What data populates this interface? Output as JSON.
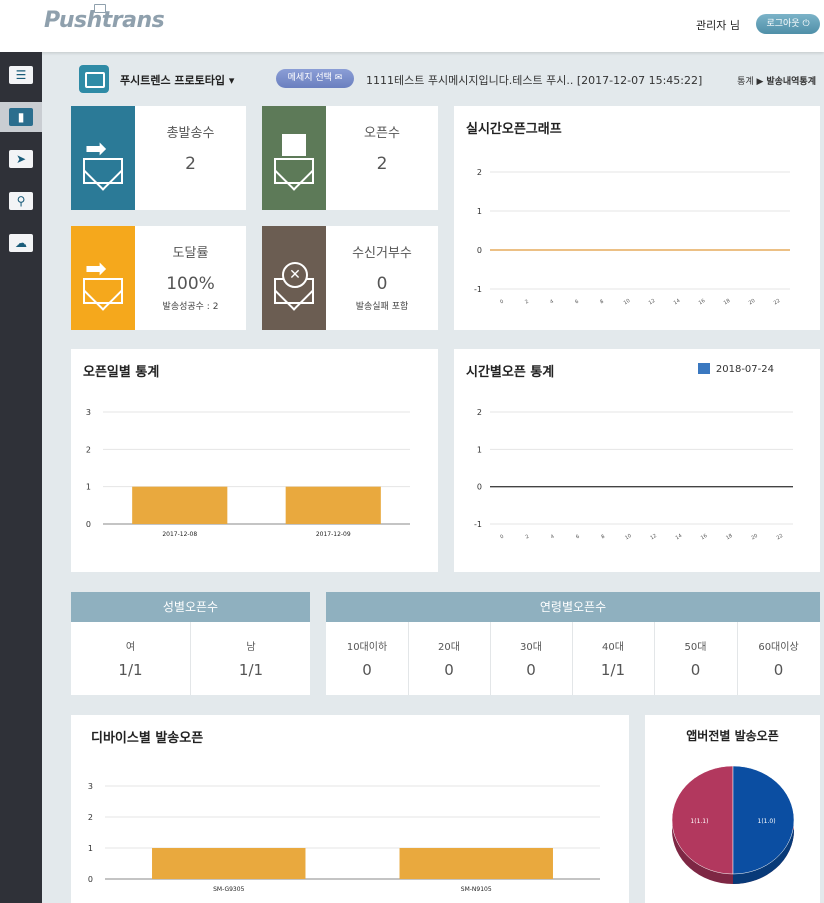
{
  "header": {
    "logo": "Pushtrans",
    "admin_label": "관리자 님",
    "logout_label": "로그아웃"
  },
  "sidebar": {
    "items": [
      {
        "name": "list-view-icon",
        "glyph": "☰"
      },
      {
        "name": "bar-chart-icon",
        "glyph": "▮"
      },
      {
        "name": "send-icon",
        "glyph": "➤"
      },
      {
        "name": "user-search-icon",
        "glyph": "⚲"
      },
      {
        "name": "cloud-upload-icon",
        "glyph": "☁"
      }
    ]
  },
  "toolbar": {
    "project_name": "푸시트렌스 프로토타입 ▾",
    "message_select_label": "메세지 선택",
    "message_text": "1111테스트 푸시메시지입니다.테스트 푸시.. [2017-12-07 15:45:22]",
    "breadcrumb_root": "통계",
    "breadcrumb_current": "발송내역통계"
  },
  "stats": {
    "total_sent": {
      "label": "총발송수",
      "value": "2"
    },
    "opens": {
      "label": "오픈수",
      "value": "2"
    },
    "delivery": {
      "label": "도달률",
      "value": "100%",
      "sub": "발송성공수 : 2"
    },
    "rejects": {
      "label": "수신거부수",
      "value": "0",
      "sub": "발송실패 포함"
    }
  },
  "colors": {
    "teal": "#2b7a97",
    "green": "#5d7a58",
    "orange": "#f5a81c",
    "brown": "#6b5d52",
    "bar": "#e9a93e",
    "pie_red": "#b2385e",
    "pie_blue": "#0b4ea2"
  },
  "realtime_chart": {
    "title": "실시간오픈그래프",
    "chart_data": {
      "type": "line",
      "x": [
        "0",
        "2",
        "4",
        "6",
        "8",
        "10",
        "12",
        "14",
        "16",
        "18",
        "20",
        "22"
      ],
      "yticks": [
        2,
        1,
        0,
        -1
      ],
      "ylim": [
        -1,
        2
      ],
      "series": [
        {
          "values": [
            0,
            0,
            0,
            0,
            0,
            0,
            0,
            0,
            0,
            0,
            0,
            0
          ]
        }
      ]
    }
  },
  "daily_chart": {
    "title": "오픈일별 통계",
    "chart_data": {
      "type": "bar",
      "categories": [
        "2017-12-08",
        "2017-12-09"
      ],
      "values": [
        1,
        1
      ],
      "yticks": [
        3,
        2,
        1,
        0
      ],
      "ylim": [
        0,
        3
      ]
    }
  },
  "hourly_chart": {
    "title": "시간별오픈 통계",
    "date": "2018-07-24",
    "chart_data": {
      "type": "line",
      "x": [
        "0",
        "2",
        "4",
        "6",
        "8",
        "10",
        "12",
        "14",
        "16",
        "18",
        "20",
        "22"
      ],
      "yticks": [
        2,
        1,
        0,
        -1
      ],
      "ylim": [
        -1,
        2
      ],
      "series": [
        {
          "values": [
            0,
            0,
            0,
            0,
            0,
            0,
            0,
            0,
            0,
            0,
            0,
            0
          ]
        }
      ]
    }
  },
  "gender_table": {
    "title": "성별오픈수",
    "columns": [
      {
        "label": "여",
        "value": "1/1"
      },
      {
        "label": "남",
        "value": "1/1"
      }
    ]
  },
  "age_table": {
    "title": "연령별오픈수",
    "columns": [
      {
        "label": "10대이하",
        "value": "0"
      },
      {
        "label": "20대",
        "value": "0"
      },
      {
        "label": "30대",
        "value": "0"
      },
      {
        "label": "40대",
        "value": "1/1"
      },
      {
        "label": "50대",
        "value": "0"
      },
      {
        "label": "60대이상",
        "value": "0"
      }
    ]
  },
  "device_chart": {
    "title": "디바이스별 발송오픈",
    "chart_data": {
      "type": "bar",
      "categories": [
        "SM-G9305",
        "SM-N9105"
      ],
      "values": [
        1,
        1
      ],
      "yticks": [
        3,
        2,
        1,
        0
      ],
      "ylim": [
        0,
        3
      ]
    }
  },
  "appversion_chart": {
    "title": "앱버전별 발송오픈",
    "chart_data": {
      "type": "pie",
      "slices": [
        {
          "label": "1(1.1)",
          "value": 1
        },
        {
          "label": "1(1.0)",
          "value": 1
        }
      ]
    }
  }
}
